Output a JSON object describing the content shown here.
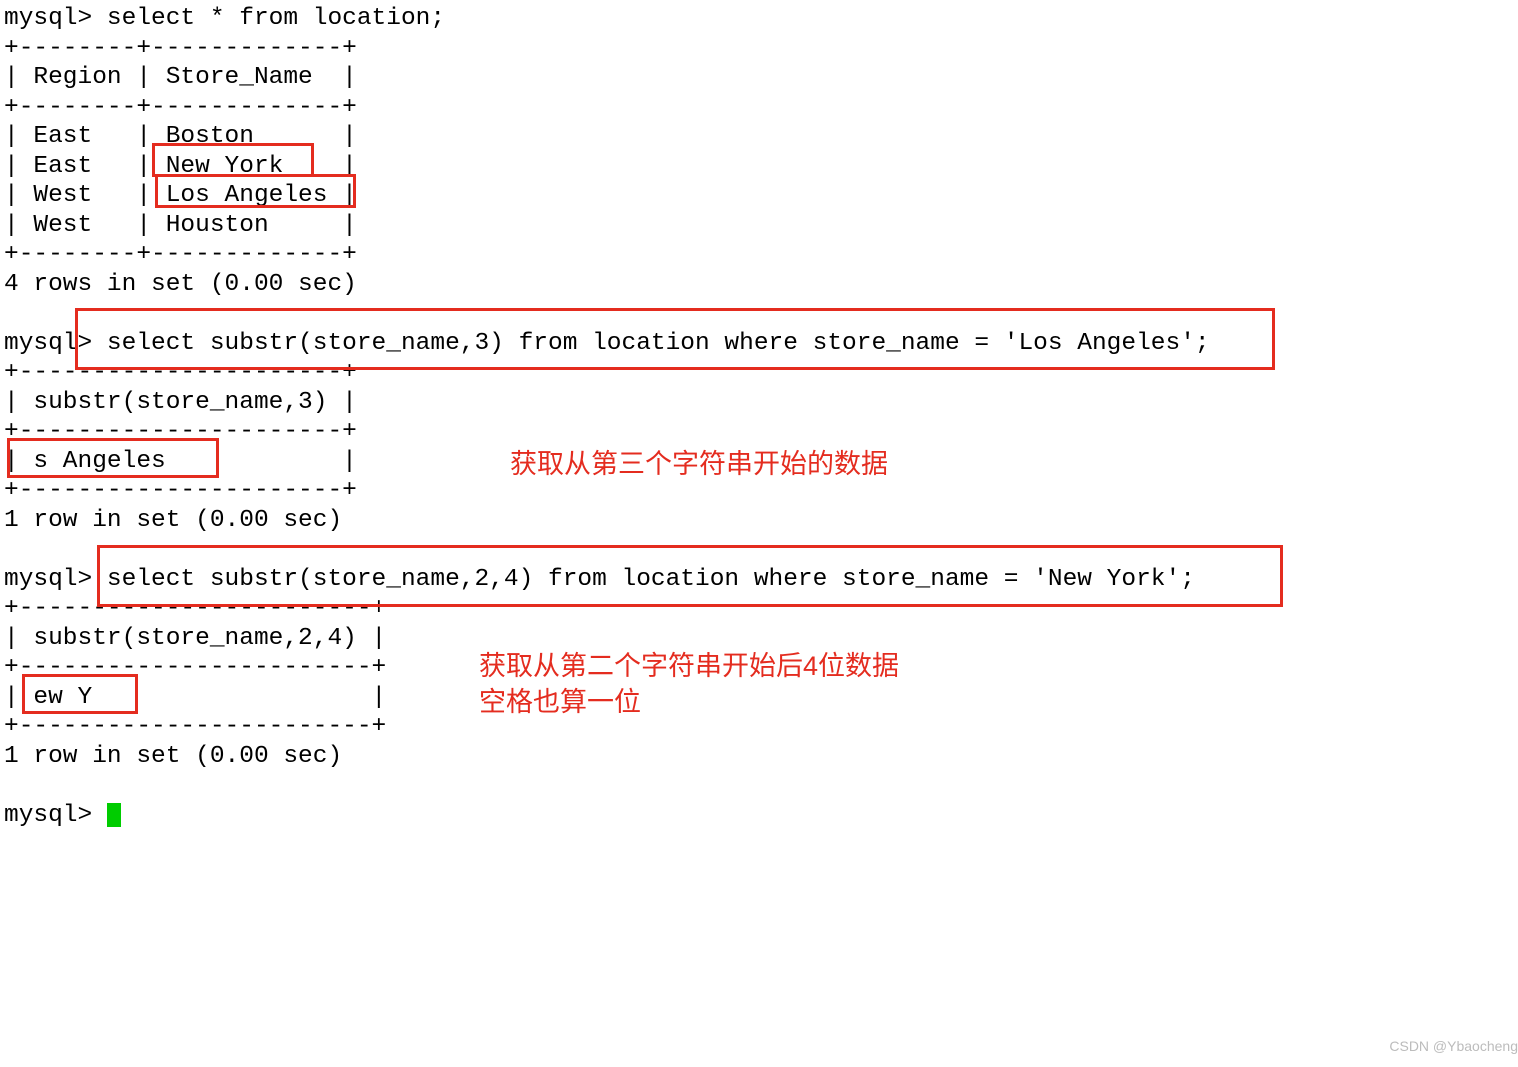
{
  "terminal": {
    "l0": "mysql> select * from location;",
    "l1": "+--------+-------------+",
    "l2": "| Region | Store_Name  |",
    "l3": "+--------+-------------+",
    "l4": "| East   | Boston      |",
    "l5": "| East   | New York    |",
    "l6": "| West   | Los Angeles |",
    "l7": "| West   | Houston     |",
    "l8": "+--------+-------------+",
    "l9": "4 rows in set (0.00 sec)",
    "l10": "",
    "l11": "mysql> select substr(store_name,3) from location where store_name = 'Los Angeles';",
    "l12": "+----------------------+",
    "l13": "| substr(store_name,3) |",
    "l14": "+----------------------+",
    "l15": "| s Angeles            |",
    "l16": "+----------------------+",
    "l17": "1 row in set (0.00 sec)",
    "l18": "",
    "l19": "mysql> select substr(store_name,2,4) from location where store_name = 'New York';",
    "l20": "+------------------------+",
    "l21": "| substr(store_name,2,4) |",
    "l22": "+------------------------+",
    "l23": "| ew Y                   |",
    "l24": "+------------------------+",
    "l25": "1 row in set (0.00 sec)",
    "l26": "",
    "l27": "mysql> "
  },
  "annotations": {
    "ann1": "获取从第三个字符串开始的数据",
    "ann2_l1": "获取从第二个字符串开始后4位数据",
    "ann2_l2": "空格也算一位"
  },
  "watermark": "CSDN @Ybaocheng"
}
